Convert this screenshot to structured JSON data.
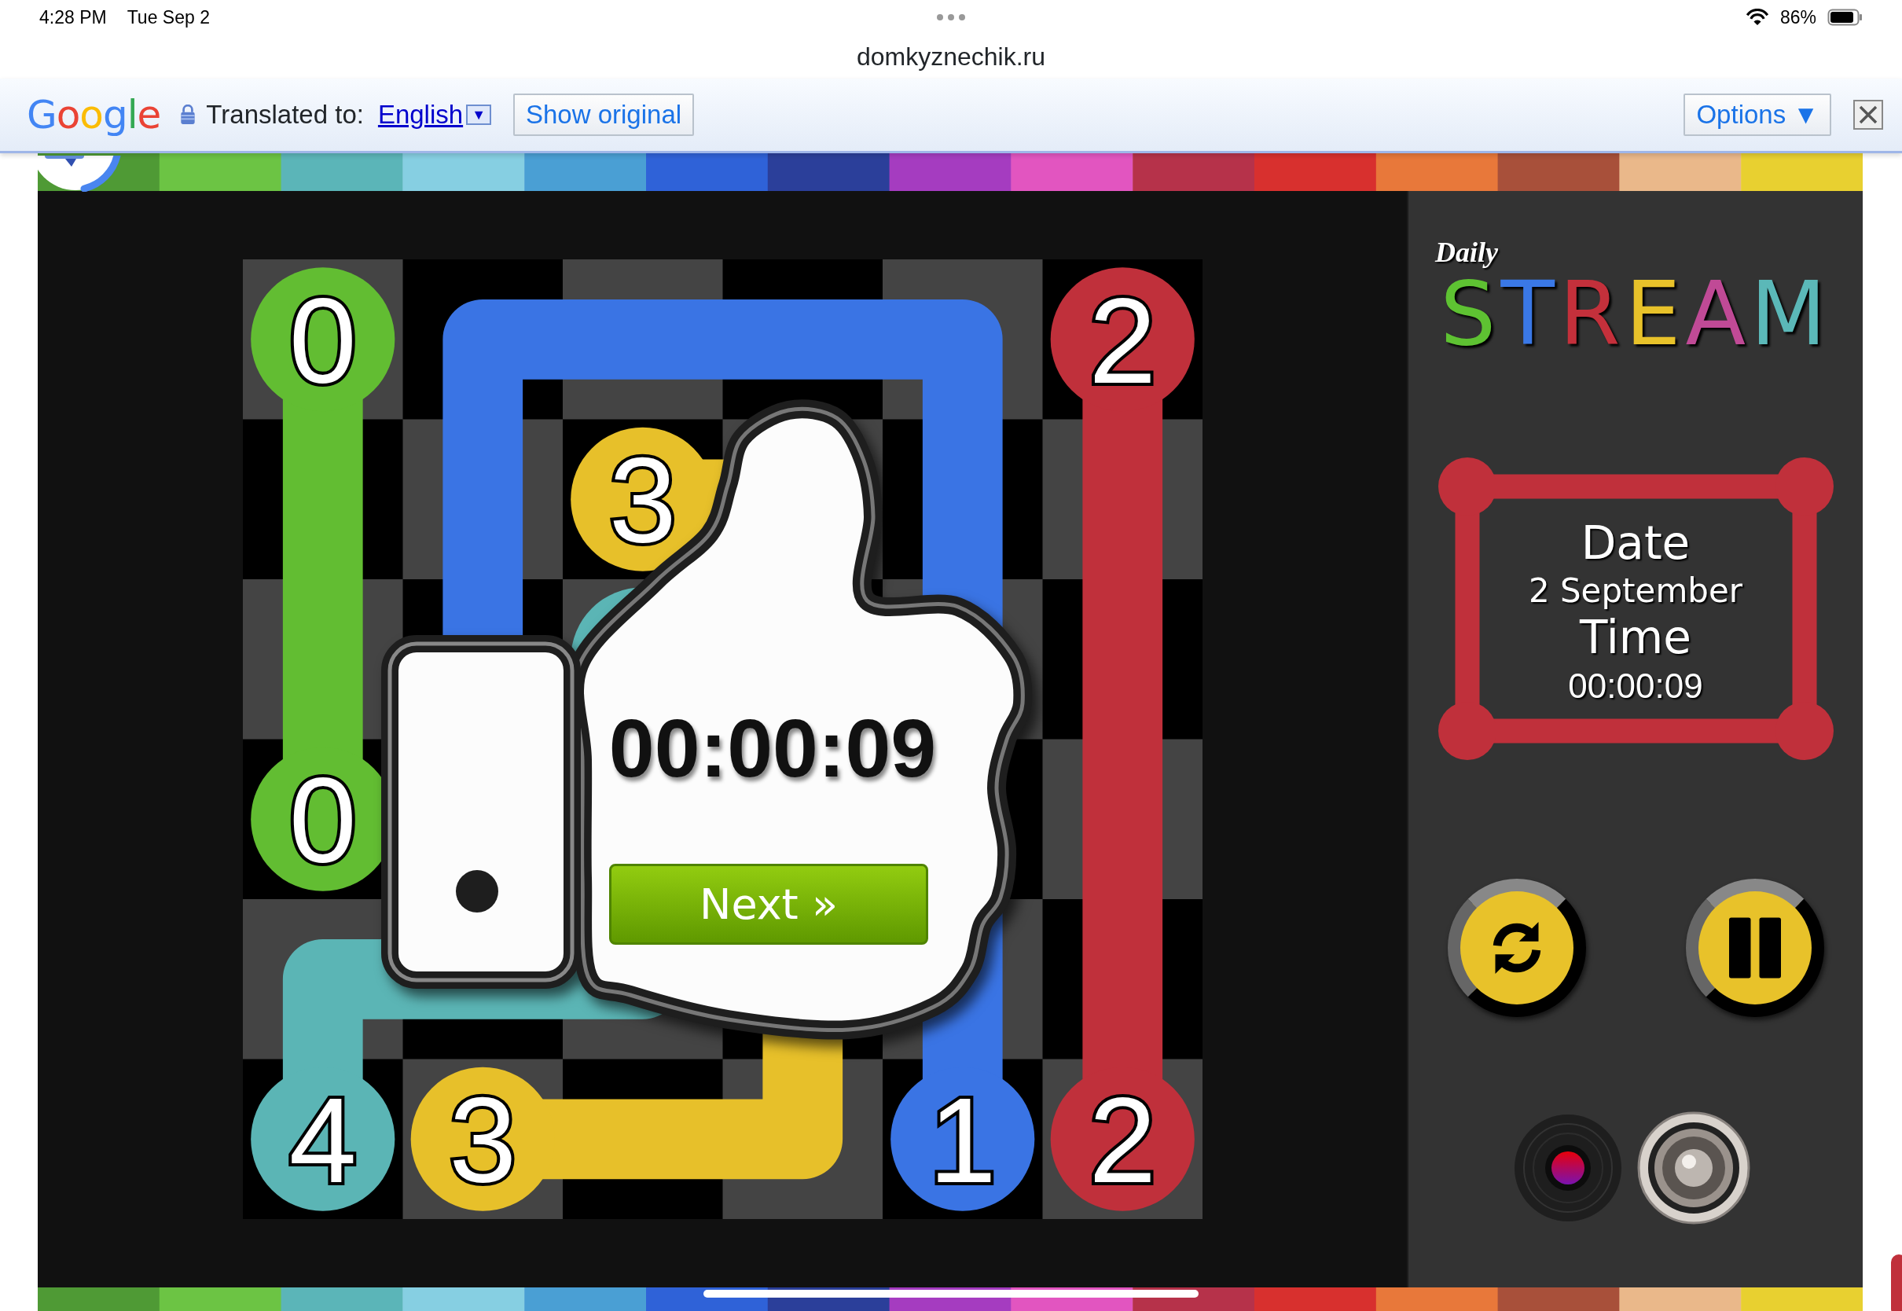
{
  "status_bar": {
    "time": "4:28 PM",
    "date": "Tue Sep 2",
    "battery": "86%"
  },
  "address_bar": {
    "url": "domkyznechik.ru"
  },
  "translate_bar": {
    "brand": "Google",
    "label": "Translated to:",
    "language": "English",
    "language_menu": "▼",
    "show_original": "Show original",
    "options": "Options ▼"
  },
  "board": {
    "flows": [
      {
        "color": "#62bd32",
        "ends": [
          {
            "kind": "numbered",
            "label": "0"
          },
          {
            "kind": "numbered",
            "label": "0"
          }
        ]
      },
      {
        "color": "#5bb5b5",
        "ends": [
          {
            "kind": "plain"
          },
          {
            "kind": "numbered",
            "label": "4"
          }
        ]
      },
      {
        "color": "#e7c02a",
        "ends": [
          {
            "kind": "numbered",
            "label": "3"
          },
          {
            "kind": "numbered",
            "label": "3"
          }
        ]
      },
      {
        "color": "#3a74e4",
        "ends": [
          {
            "kind": "numbered",
            "label": "1"
          }
        ]
      },
      {
        "color": "#c0303b",
        "ends": [
          {
            "kind": "numbered",
            "label": "2"
          },
          {
            "kind": "numbered",
            "label": "2"
          }
        ]
      }
    ]
  },
  "overlay": {
    "timer": "00:00:09",
    "next": "Next »"
  },
  "sidebar": {
    "subtitle": "Daily",
    "title": "STREAM",
    "info": [
      {
        "kind": "heading",
        "text": "Date"
      },
      {
        "kind": "value",
        "text": "2 September"
      },
      {
        "kind": "heading",
        "text": "Time"
      },
      {
        "kind": "value",
        "text": "00:00:09"
      }
    ],
    "controls": [
      {
        "kind": "restart"
      },
      {
        "kind": "pause"
      }
    ],
    "media": [
      {
        "kind": "record"
      },
      {
        "kind": "speaker"
      }
    ]
  }
}
